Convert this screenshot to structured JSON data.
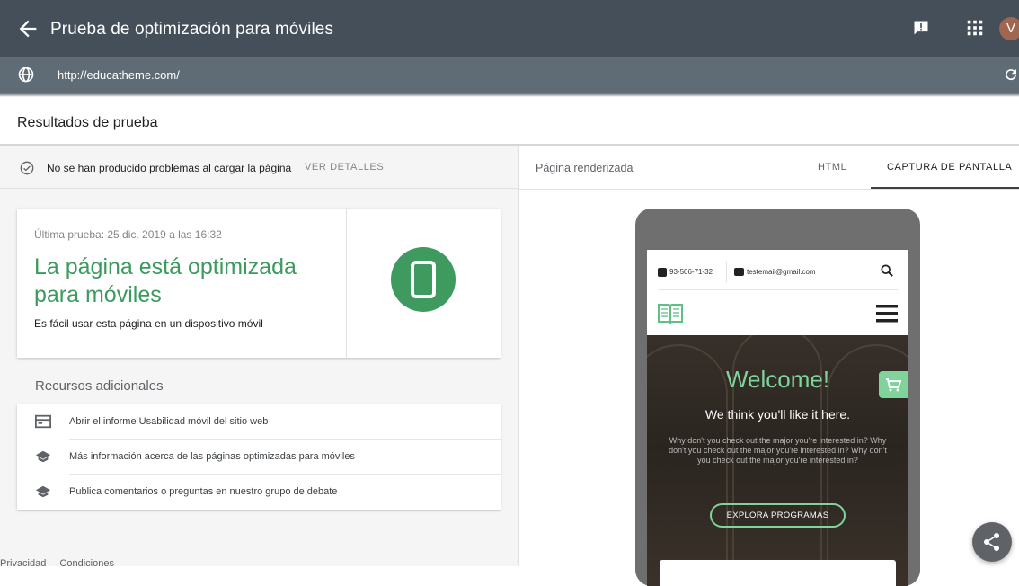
{
  "header": {
    "title": "Prueba de optimización para móviles",
    "avatar_letter": "V"
  },
  "urlbar": {
    "url": "http://educatheme.com/"
  },
  "section_title": "Resultados de prueba",
  "status": {
    "message": "No se han producido problemas al cargar la página",
    "details_label": "VER DETALLES"
  },
  "result": {
    "date": "Última prueba: 25 dic. 2019 a las 16:32",
    "headline": "La página está optimizada para móviles",
    "subtitle": "Es fácil usar esta página en un dispositivo móvil",
    "accent_color": "#3c9a5f"
  },
  "resources": {
    "title": "Recursos adicionales",
    "items": [
      {
        "label": "Abrir el informe Usabilidad móvil del sitio web",
        "icon": "report-icon"
      },
      {
        "label": "Más información acerca de las páginas optimizadas para móviles",
        "icon": "school-icon"
      },
      {
        "label": "Publica comentarios o preguntas en nuestro grupo de debate",
        "icon": "school-icon"
      }
    ]
  },
  "footer": {
    "links": [
      "Privacidad",
      "Condiciones"
    ]
  },
  "tabs": {
    "rendered_label": "Página renderizada",
    "html": "HTML",
    "screenshot": "CAPTURA DE PANTALLA"
  },
  "preview": {
    "phone": "93-506-71-32",
    "email": "testemail@gmail.com",
    "welcome": "Welcome!",
    "tagline": "We think you'll like it here.",
    "body": "Why don't you check out the major you're interested in? Why don't you check out the major you're interested in? Why don't you check out the major you're interested in?",
    "cta": "EXPLORA PROGRAMAS",
    "accent_color": "#7fd39b"
  }
}
